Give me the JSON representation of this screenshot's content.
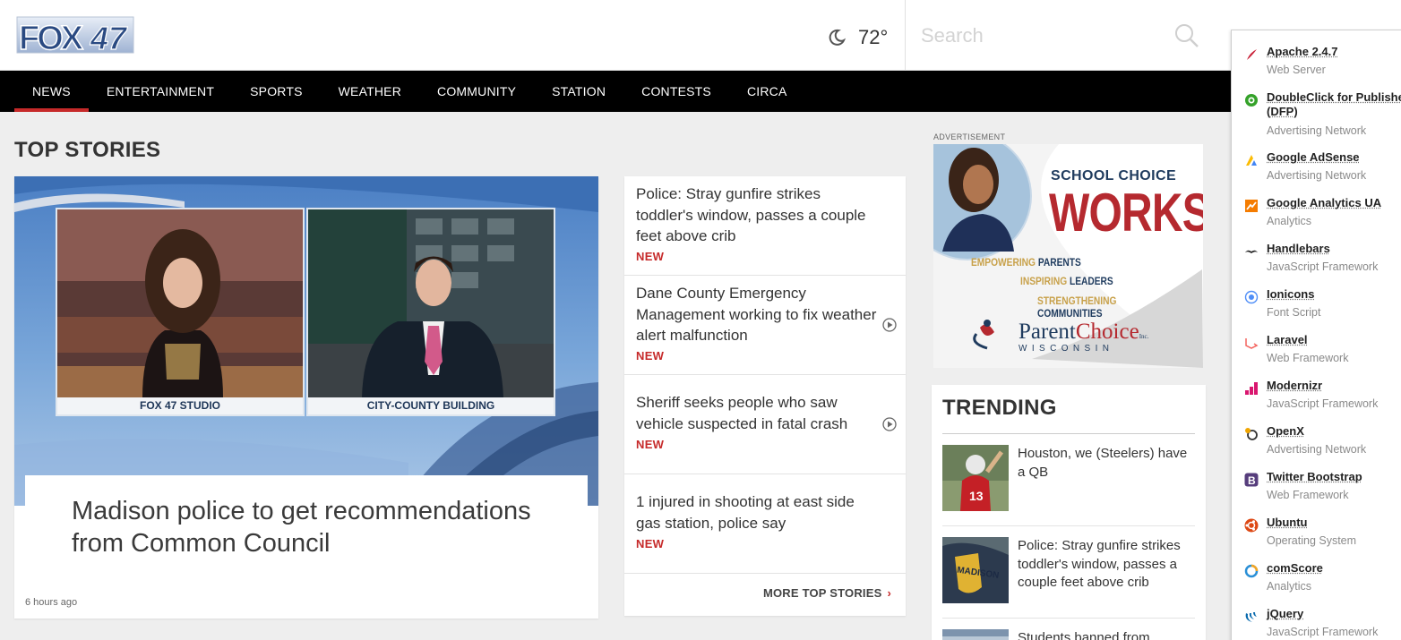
{
  "header": {
    "logo_fox": "FOX",
    "logo_num": "47",
    "weather_icon": "moon-icon",
    "temperature": "72°",
    "search_placeholder": "Search"
  },
  "nav": {
    "items": [
      "NEWS",
      "ENTERTAINMENT",
      "SPORTS",
      "WEATHER",
      "COMMUNITY",
      "STATION",
      "CONTESTS",
      "CIRCA"
    ],
    "active": "NEWS"
  },
  "top_stories": {
    "title": "TOP STORIES",
    "hero": {
      "caption_left": "FOX 47 STUDIO",
      "caption_right": "CITY-COUNTY BUILDING",
      "headline": "Madison police to get recommendations from Common Council",
      "time": "6 hours ago"
    },
    "stories": [
      {
        "title": "Police: Stray gunfire strikes toddler's window, passes a couple feet above crib",
        "badge": "NEW",
        "video": false
      },
      {
        "title": "Dane County Emergency Management working to fix weather alert malfunction",
        "badge": "NEW",
        "video": true
      },
      {
        "title": "Sheriff seeks people who saw vehicle suspected in fatal crash",
        "badge": "NEW",
        "video": true
      },
      {
        "title": "1 injured in shooting at east side gas station, police say",
        "badge": "NEW",
        "video": false
      }
    ],
    "more_label": "MORE TOP STORIES",
    "more_chevron": "›"
  },
  "ad": {
    "label": "ADVERTISEMENT",
    "headline_1": "SCHOOL CHOICE",
    "headline_2": "WORKS",
    "tag_1_word": "EMPOWERING",
    "tag_1_rest": "PARENTS",
    "tag_2_word": "INSPIRING",
    "tag_2_rest": "LEADERS",
    "tag_3_word": "STRENGTHENING",
    "tag_3_rest": "COMMUNITIES",
    "brand_a": "Parent",
    "brand_b": "Choice",
    "brand_inc": "Inc.",
    "brand_sub": "WISCONSIN"
  },
  "trending": {
    "title": "TRENDING",
    "items": [
      {
        "text": "Houston, we (Steelers) have a QB"
      },
      {
        "text": "Police: Stray gunfire strikes toddler's window, passes a couple feet above crib"
      },
      {
        "text": "Students banned from"
      }
    ]
  },
  "wappalyzer": {
    "items": [
      {
        "name": "Apache 2.4.7",
        "category": "Web Server",
        "icon": "apache-feather-icon",
        "color": "#c92037"
      },
      {
        "name": "DoubleClick for Publishers (DFP)",
        "category": "Advertising Network",
        "icon": "doubleclick-icon",
        "color": "#35a22a"
      },
      {
        "name": "Google AdSense",
        "category": "Advertising Network",
        "icon": "adsense-icon",
        "color": "#fbbc04"
      },
      {
        "name": "Google Analytics UA",
        "category": "Analytics",
        "icon": "analytics-icon",
        "color": "#f57c00"
      },
      {
        "name": "Handlebars",
        "category": "JavaScript Framework",
        "icon": "handlebars-icon",
        "color": "#222222"
      },
      {
        "name": "Ionicons",
        "category": "Font Script",
        "icon": "ionicons-icon",
        "color": "#4f8ef7"
      },
      {
        "name": "Laravel",
        "category": "Web Framework",
        "icon": "laravel-icon",
        "color": "#f4645f"
      },
      {
        "name": "Modernizr",
        "category": "JavaScript Framework",
        "icon": "modernizr-icon",
        "color": "#d9166f"
      },
      {
        "name": "OpenX",
        "category": "Advertising Network",
        "icon": "openx-icon",
        "color": "#f0a500"
      },
      {
        "name": "Twitter Bootstrap",
        "category": "Web Framework",
        "icon": "bootstrap-icon",
        "color": "#563d7c"
      },
      {
        "name": "Ubuntu",
        "category": "Operating System",
        "icon": "ubuntu-icon",
        "color": "#dd4814"
      },
      {
        "name": "comScore",
        "category": "Analytics",
        "icon": "comscore-icon",
        "color": "#2a8fd6"
      },
      {
        "name": "jQuery",
        "category": "JavaScript Framework",
        "icon": "jquery-icon",
        "color": "#0769ad"
      }
    ]
  }
}
